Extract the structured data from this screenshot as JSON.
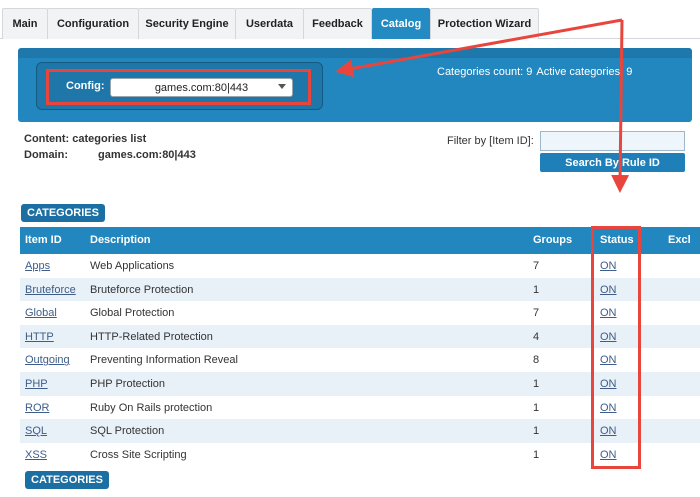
{
  "tabs": [
    {
      "label": "Main"
    },
    {
      "label": "Configuration"
    },
    {
      "label": "Security Engine"
    },
    {
      "label": "Userdata"
    },
    {
      "label": "Feedback"
    },
    {
      "label": "Catalog",
      "active": true
    },
    {
      "label": "Protection Wizard"
    }
  ],
  "config": {
    "label": "Config:",
    "selected": "games.com:80|443"
  },
  "counts": {
    "categories": "Categories count: 9",
    "active": "Active categories: 9"
  },
  "content": {
    "content_label": "Content: categories list",
    "domain_label": "Domain:",
    "domain_value": "games.com:80|443"
  },
  "filter": {
    "label": "Filter by [Item ID]:",
    "value": "",
    "search_label": "Search By Rule ID"
  },
  "categories_button": "CATEGORIES",
  "table": {
    "headers": {
      "item_id": "Item ID",
      "description": "Description",
      "groups": "Groups",
      "status": "Status",
      "excl": "Excl"
    },
    "rows": [
      {
        "id": "Apps",
        "description": "Web Applications",
        "groups": "7",
        "status": "ON"
      },
      {
        "id": "Bruteforce",
        "description": "Bruteforce Protection",
        "groups": "1",
        "status": "ON"
      },
      {
        "id": "Global",
        "description": "Global Protection",
        "groups": "7",
        "status": "ON"
      },
      {
        "id": "HTTP",
        "description": "HTTP-Related Protection",
        "groups": "4",
        "status": "ON"
      },
      {
        "id": "Outgoing",
        "description": "Preventing Information Reveal",
        "groups": "8",
        "status": "ON"
      },
      {
        "id": "PHP",
        "description": "PHP Protection",
        "groups": "1",
        "status": "ON"
      },
      {
        "id": "ROR",
        "description": "Ruby On Rails protection",
        "groups": "1",
        "status": "ON"
      },
      {
        "id": "SQL",
        "description": "SQL Protection",
        "groups": "1",
        "status": "ON"
      },
      {
        "id": "XSS",
        "description": "Cross Site Scripting",
        "groups": "1",
        "status": "ON"
      }
    ]
  },
  "colors": {
    "accent": "#2287bf",
    "highlight": "#e8453c"
  }
}
